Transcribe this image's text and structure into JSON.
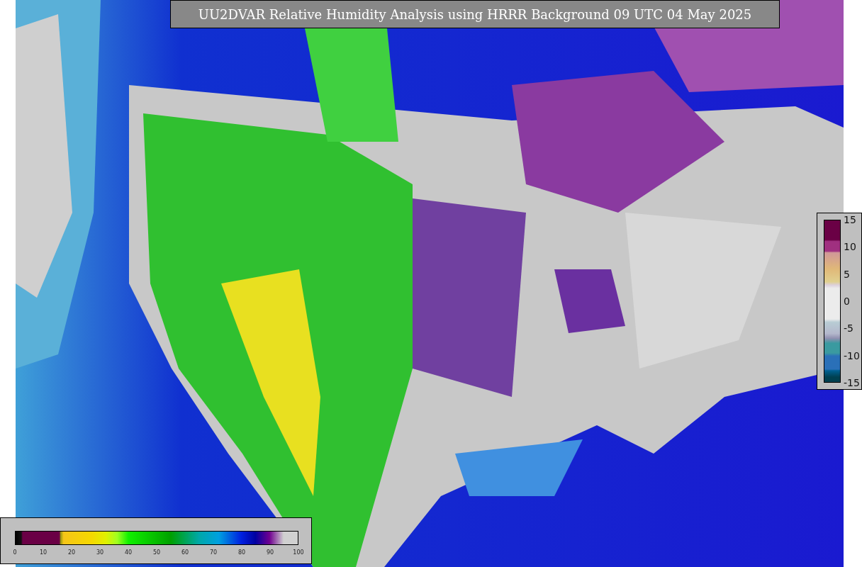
{
  "title": "UU2DVAR Relative Humidity Analysis using HRRR Background 09 UTC 04 May 2025",
  "humidity_scale": {
    "ticks": [
      "0",
      "10",
      "20",
      "30",
      "40",
      "50",
      "60",
      "70",
      "80",
      "90",
      "100"
    ]
  },
  "difference_scale": {
    "ticks": [
      "15",
      "10",
      "5",
      "0",
      "-5",
      "-10",
      "-15"
    ]
  }
}
